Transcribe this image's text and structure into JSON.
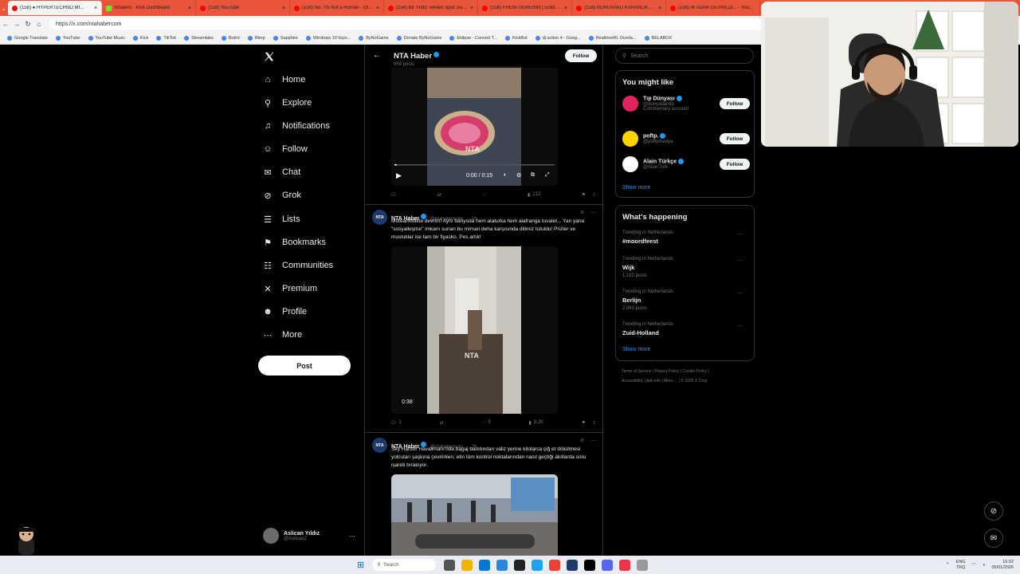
{
  "browser": {
    "tabs": [
      {
        "label": "(158) ● HYPERTECHNO MI..."
      },
      {
        "label": "Streams - Kick Dashboard"
      },
      {
        "label": "(158) YouTube"
      },
      {
        "label": "(158) No, I'm Not a Human - Offi..."
      },
      {
        "label": "(158) Bir Yıldız Verilen Spor Salonı..."
      },
      {
        "label": "(158) FRENİ ÖĞRENİN | 5Sliders |..."
      },
      {
        "label": "(158) NORUVAKU KARANLIK YÜZ..."
      },
      {
        "label": "(158) İKTİDAR DEVRİLDİ... - You..."
      }
    ],
    "url": "https://x.com/ntahabercom",
    "bookmarks": [
      "Google Translate",
      "YouTube",
      "YouTube Music",
      "Kick",
      "TikTok",
      "Streamlabs",
      "Botrix",
      "Blerp",
      "Sapphire",
      "Windows 10 hiçin...",
      "ByNoGame",
      "Donate ByNoGame",
      "Eklipse - Convert T...",
      "KickBot",
      "dj action 4 - Goog...",
      "RealtimeRL Overla...",
      "BELABOX"
    ]
  },
  "nav": {
    "items": [
      {
        "label": "Home",
        "icon": "home-icon"
      },
      {
        "label": "Explore",
        "icon": "search-icon"
      },
      {
        "label": "Notifications",
        "icon": "bell-icon"
      },
      {
        "label": "Follow",
        "icon": "follow-icon"
      },
      {
        "label": "Chat",
        "icon": "mail-icon"
      },
      {
        "label": "Grok",
        "icon": "grok-icon"
      },
      {
        "label": "Lists",
        "icon": "list-icon"
      },
      {
        "label": "Bookmarks",
        "icon": "bookmark-icon"
      },
      {
        "label": "Communities",
        "icon": "communities-icon"
      },
      {
        "label": "Premium",
        "icon": "x-icon"
      },
      {
        "label": "Profile",
        "icon": "profile-icon"
      },
      {
        "label": "More",
        "icon": "more-icon"
      }
    ],
    "post_label": "Post",
    "user": {
      "name": "Aslican Yıldız",
      "handle": "@AslicanZ"
    }
  },
  "feed": {
    "header": {
      "name": "NTA Haber",
      "posts": "959 posts",
      "follow": "Follow"
    },
    "video1": {
      "time": "0:00 / 0:15",
      "views": "212"
    },
    "tweet1": {
      "name": "NTA Haber",
      "handle": "@ntahabercom",
      "time": "1h",
      "text": "Müteahhitlikte devrim! Aynı banyoda hem alaturka hem alafranga tuvalet... Yan yana \"sosyalleşme\" imkanı sunan bu mimari deha karşısında dilimiz tutuldu! Prizler ve musluklar ise tam bir fiyasko. Pes artık!",
      "duration": "0:38",
      "replies": "1",
      "likes": "5",
      "views": "9.2K"
    },
    "tweet2": {
      "name": "NTA Haber",
      "handle": "@ntahabercom",
      "time": "2h",
      "text": "Sky Harbor Havalimanı'nda bagaj bandından valiz yerine kilolarca çiğ et dökülmesi yolcuları şaşkına çevirirken; etin tüm kontrol noktalarından nasıl geçtiği akıllarda soru işareti bırakıyor."
    }
  },
  "right": {
    "search_placeholder": "Search",
    "might_like": {
      "title": "You might like",
      "users": [
        {
          "name": "Tıp Dünyası",
          "handle": "@dunyadantip",
          "note": "Commentary account",
          "color": "#e0245e"
        },
        {
          "name": "poftp.",
          "handle": "@poftpmedya",
          "note": "",
          "color": "#ffd400"
        },
        {
          "name": "Alain Türkçe",
          "handle": "@AlainTurk",
          "note": "",
          "color": "#ffffff"
        }
      ],
      "follow_label": "Follow",
      "show_more": "Show more"
    },
    "happening": {
      "title": "What's happening",
      "trends": [
        {
          "context": "Trending in Netherlands",
          "topic": "#moordfeest",
          "posts": ""
        },
        {
          "context": "Trending in Netherlands",
          "topic": "Wijk",
          "posts": "1,162 posts"
        },
        {
          "context": "Trending in Netherlands",
          "topic": "Berlijn",
          "posts": "2,843 posts"
        },
        {
          "context": "Trending in Netherlands",
          "topic": "Zuid-Holland",
          "posts": ""
        }
      ],
      "show_more": "Show more"
    },
    "footer": [
      "Terms of Service",
      "Privacy Policy",
      "Cookie Policy",
      "Accessibility",
      "Ads info",
      "More ...",
      "© 2026 X Corp."
    ]
  },
  "taskbar": {
    "search": "Search",
    "lang1": "ENG",
    "lang2": "TRQ",
    "time": "16:02",
    "date": "05/01/2026"
  },
  "colors": {
    "accent": "#1d9bf0",
    "tabbar": "#e8553b",
    "background": "#000000"
  }
}
